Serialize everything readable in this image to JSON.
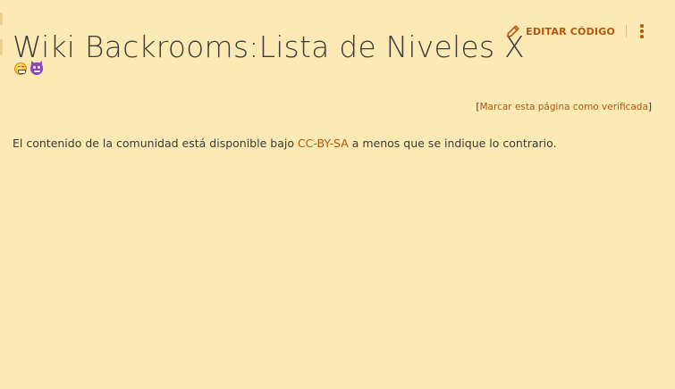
{
  "page": {
    "title": "Wiki Backrooms:Lista de Niveles X"
  },
  "header_actions": {
    "edit_source_label": "EDITAR CÓDIGO",
    "edit_icon": "pencil-icon",
    "more_icon": "kebab-menu-icon"
  },
  "emoji_row": [
    {
      "name": "grinning-face-emoji"
    },
    {
      "name": "smiling-devil-emoji"
    }
  ],
  "verification": {
    "open_bracket": "[",
    "link_label": "Marcar esta página como verificada",
    "close_bracket": "]"
  },
  "footer_license": {
    "prefix": "El contenido de la comunidad está disponible bajo ",
    "link_label": "CC-BY-SA",
    "suffix": " a menos que se indique lo contrario."
  },
  "colors": {
    "background": "#fde9b3",
    "accent": "#b5560e",
    "text": "#3a3a3a"
  }
}
